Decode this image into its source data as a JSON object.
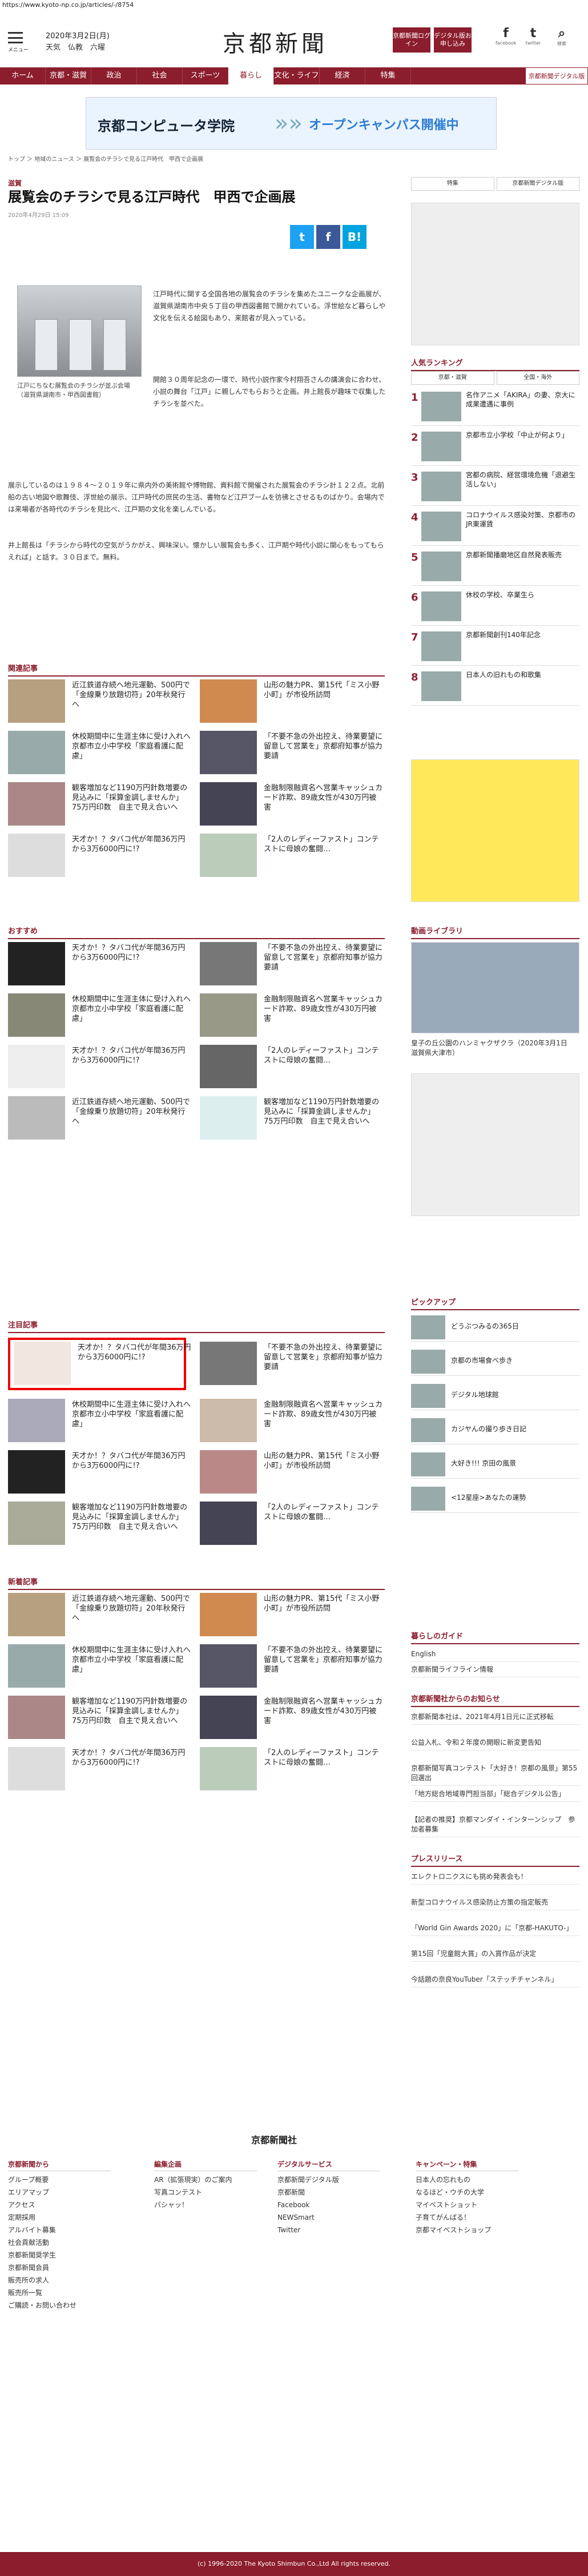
{
  "url": "https://www.kyoto-np.co.jp/articles/-/8754",
  "header": {
    "menu": "メニュー",
    "date": "2020年3月2日(月)",
    "weather": "天気　仏教　六曜",
    "logo": "京都新聞",
    "login": "京都新聞ログイン",
    "digital": "デジタル版お申し込み",
    "sns": [
      "f",
      "🐦",
      "🔍"
    ],
    "sns_lbls": [
      "facebook",
      "twitter",
      "検索"
    ]
  },
  "nav": [
    "ホーム",
    "京都・滋賀",
    "政治",
    "社会",
    "スポーツ",
    "暮らし",
    "文化・ライフ",
    "経済",
    "特集"
  ],
  "nav_right": "京都新聞デジタル版",
  "banner": {
    "school": "京都コンピュータ学院",
    "event": "オープンキャンパス開催中"
  },
  "breadcrumb": "トップ ＞ 地域のニュース ＞ 展覧会のチラシで見る江戸時代　甲西で企画展",
  "article": {
    "category": "滋賀",
    "title": "展覧会のチラシで見る江戸時代　甲西で企画展",
    "date": "2020年4月29日 15:09",
    "caption": "江戸にちなむ展覧会のチラシが並ぶ会場（滋賀県湖南市・甲西図書館）",
    "p1": "江戸時代に関する全国各地の展覧会のチラシを集めたユニークな企画展が、滋賀県湖南市中央５丁目の甲西図書館で開かれている。浮世絵など暮らしや文化を伝える絵図もあり、来館者が見入っている。",
    "p2": "開館３０周年記念の一環で、時代小説作家今村翔吾さんの講演会に合わせ、小説の舞台「江戸」に親しんでもらおうと企画。井上館長が趣味で収集したチラシを並べた。",
    "p3": "展示しているのは１９８４～２０１９年に県内外の美術館や博物館、資料館で開催された展覧会のチラシ計１２２点。北前船の古い地図や歌舞伎、浮世絵の展示、江戸時代の庶民の生活、書物など江戸ブームを彷彿とさせるものばかり。会場内では来場者が各時代のチラシを見比べ、江戸期の文化を楽しんでいる。",
    "p4": "井上館長は「チラシから時代の空気がうかがえ、興味深い。懐かしい展覧会も多く、江戸期や時代小説に関心をもってもらえれば」と話す。３０日まで。無料。"
  },
  "sections": {
    "related": "関連記事",
    "recommend": "おすすめ",
    "featured": "注目記事",
    "latest": "新着記事"
  },
  "cards": [
    "近江鉄道存続へ地元運動、500円で「金線乗り放題切符」20年秋発行へ",
    "山形の魅力PR、第15代「ミス小野小町」が市役所訪問",
    "休校期間中に生涯主体に受け入れへ　京都市立小中学校「家庭看護に配慮」",
    "「不要不急の外出控え、待業要望に留意して営業を」京都府知事が協力要請",
    "観客増加など1190万円針数増要の見込みに「採算金調しませんか」75万円印数　自主で見え合いへ",
    "金融制限融資名へ営業キャッシュカード詐欺、89歳女性が430万円被害",
    "天才か！？タバコ代が年間36万円から3万6000円に!?",
    "「2人のレディーファスト」コンテストに母娘の奮闘…"
  ],
  "rank_tabs": [
    "京都・滋賀",
    "全国・海外"
  ],
  "ranking": [
    "名作アニメ「AKIRA」の妻、京大に成果遭遇に事例",
    "京都市立小学校「中止が何より」",
    "宮都の病院、経営環境危機「退避生活しない」",
    "コロナウイルス感染対策、京都市のJR東運賃",
    "京都新聞播磨地区自然発表販売",
    "休校の学校、卒業生ら",
    "京都新聞創刊140年記念",
    "日本人の旧れもの和歌集"
  ],
  "pickup_head": "ピックアップ",
  "pickup": [
    "どうぶつみるの365日",
    "京都の市場食べ歩き",
    "デジタル地球館",
    "カジヤんの撮り歩き日記",
    "大好き!!! 京田の風景",
    "<12星座>あなたの運勢"
  ],
  "guide_head": "暮らしのガイド",
  "guide": [
    "English",
    "京都新聞ライフライン情報"
  ],
  "notice_head": "京都新聞社からのお知らせ",
  "notice": [
    "京都新聞本社は、2021年4月1日元に正式移転",
    "公益入札、令和２年度の開眼に新変更告知",
    "京都新聞写真コンテスト「大好き！京都の風景」第55回選出",
    "「地方総合地域専門担当部」「総合デジタル公告」",
    "【記者の推奨】京都マンダイ・インターンシップ　参加者募集"
  ],
  "press_head": "プレスリリース",
  "press": [
    "エレクトロニクスにも挑め発表会も！",
    "新型コロナウイルス感染防止方策の指定販売",
    "「World Gin Awards 2020」に「京都-HAKUTO-」",
    "第15回「児童館大賞」の入賞作品が決定",
    "今話題の奈良YouTuber「ステッチチャンネル」"
  ],
  "video_head": "動画ライブラリ",
  "video_caption": "皇子の丘公園のハンミャクザクラ（2020年3月1日　滋賀県大津市）",
  "footer": {
    "logo": "京都新聞社",
    "cols": [
      {
        "h": "京都新聞から",
        "items": [
          "グループ概要",
          "エリアマップ",
          "アクセス",
          "定期採用",
          "アルバイト募集",
          "社会貢献活動",
          "京都新聞奨学生",
          "京都新聞会員",
          "販売所の求人",
          "販売所一覧",
          "ご購読・お問い合わせ"
        ]
      },
      {
        "h": "編集企画",
        "items": [
          "AR（拡張現実）のご案内",
          "写真コンテスト",
          "パシャッ！"
        ]
      },
      {
        "h": "デジタルサービス",
        "items": [
          "京都新聞デジタル版",
          "京都新聞",
          "Facebook",
          "NEWSmart",
          "Twitter"
        ]
      },
      {
        "h": "キャンペーン・特集",
        "items": [
          "日本人の忘れもの",
          "なるほど・ウチの大学",
          "マイベストショット",
          "子育てがんばる！",
          "京都マイベストショップ"
        ]
      }
    ]
  },
  "copyright": "(c) 1996-2020 The Kyoto Shimbun Co.,Ltd All rights reserved."
}
